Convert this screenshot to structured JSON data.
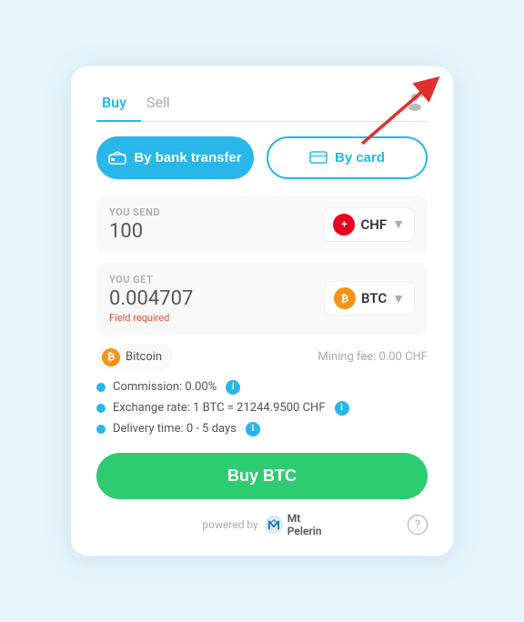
{
  "tabs": [
    {
      "label": "Buy",
      "active": true
    },
    {
      "label": "Sell",
      "active": false
    }
  ],
  "payment_methods": {
    "bank_label": "By bank transfer",
    "card_label": "By card"
  },
  "send_section": {
    "label": "YOU SEND",
    "amount": "100",
    "currency_code": "CHF",
    "currency_symbol": "+"
  },
  "get_section": {
    "label": "YOU GET",
    "amount": "0.004707",
    "currency_code": "BTC",
    "field_required": "Field required"
  },
  "info_row": {
    "coin_name": "Bitcoin",
    "mining_fee": "Mining fee: 0.00 CHF"
  },
  "details": [
    {
      "text": "Commission: 0.00%",
      "has_info": true
    },
    {
      "text": "Exchange rate: 1 BTC = 21244.9500 CHF",
      "has_info": true
    },
    {
      "text": "Delivery time: 0 - 5 days",
      "has_info": true
    }
  ],
  "buy_button": {
    "label": "Buy BTC"
  },
  "footer": {
    "powered_by": "powered by",
    "brand": "Mt\nPelerin",
    "help_label": "?"
  }
}
